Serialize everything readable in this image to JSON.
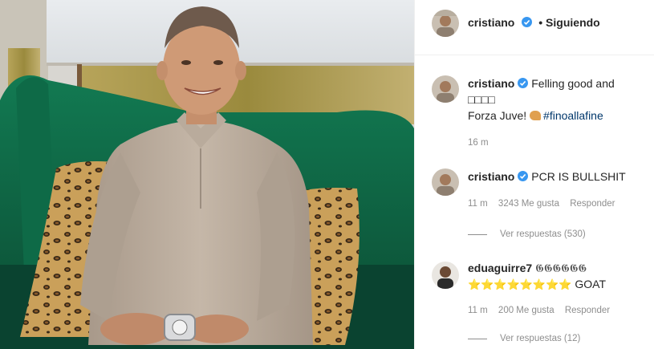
{
  "header": {
    "username": "cristiano",
    "follow_label": "• Siguiendo"
  },
  "caption": {
    "username": "cristiano",
    "text_line1": "Felling good and",
    "text_line2": "□□□□",
    "text_line3": "Forza Juve!",
    "hashtag": "#finoallafine",
    "time": "16 m"
  },
  "comments": [
    {
      "username": "cristiano",
      "text": "PCR IS BULLSHIT",
      "time": "11 m",
      "likes": "3243 Me gusta",
      "reply_label": "Responder",
      "view_replies": "Ver respuestas (530)"
    },
    {
      "username": "eduaguirre7",
      "text_prefix": "𝕲𝕲𝕲𝕲𝕲𝕲",
      "stars": "⭐⭐⭐⭐⭐⭐⭐⭐",
      "text": "GOAT",
      "time": "11 m",
      "likes": "200 Me gusta",
      "reply_label": "Responder",
      "view_replies": "Ver respuestas (12)"
    }
  ],
  "colors": {
    "verified_blue": "#3897f0",
    "sofa_green": "#0f5a3e",
    "shirt": "#b7a898",
    "leopard_base": "#c79a4f"
  }
}
